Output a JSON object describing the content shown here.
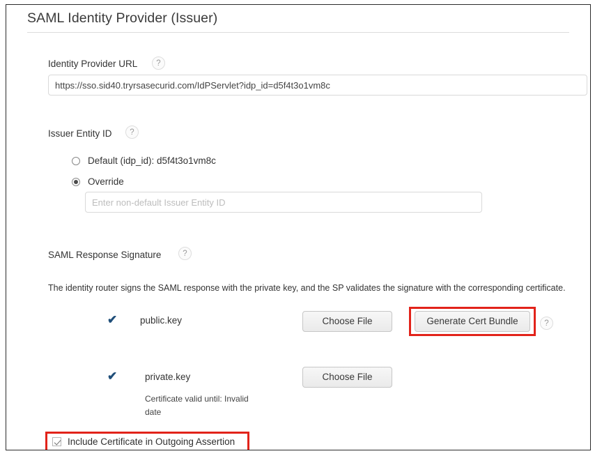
{
  "page": {
    "title": "SAML Identity Provider (Issuer)"
  },
  "identity_provider_url": {
    "label": "Identity Provider URL",
    "help_icon": "?",
    "value": "https://sso.sid40.tryrsasecurid.com/IdPServlet?idp_id=d5f4t3o1vm8c",
    "placeholder": ""
  },
  "issuer_entity_id": {
    "label": "Issuer Entity ID",
    "help_icon": "?",
    "options": [
      {
        "label": "Default (idp_id): d5f4t3o1vm8c",
        "selected": false
      },
      {
        "label": "Override",
        "selected": true
      }
    ],
    "override_input": {
      "value": "",
      "placeholder": "Enter non-default Issuer Entity ID"
    }
  },
  "saml_response_signature": {
    "label": "SAML Response Signature",
    "help_icon": "?",
    "description": "The identity router signs the SAML response with the private key, and the SP validates the signature with the corresponding certificate.",
    "keys": [
      {
        "status_icon": "check-icon",
        "name": "public.key",
        "choose_file_label": "Choose File",
        "generate_label": "Generate Cert Bundle",
        "generate_help_icon": "?",
        "sub_text": ""
      },
      {
        "status_icon": "check-icon",
        "name": "private.key",
        "choose_file_label": "Choose File",
        "sub_text": "Certificate valid until: Invalid date"
      }
    ]
  },
  "include_certificate": {
    "label": "Include Certificate in Outgoing Assertion",
    "checked": true
  },
  "colors": {
    "annotation_red": "#e2231a",
    "check_blue": "#1f4e79",
    "border_gray": "#d9d9d9"
  }
}
